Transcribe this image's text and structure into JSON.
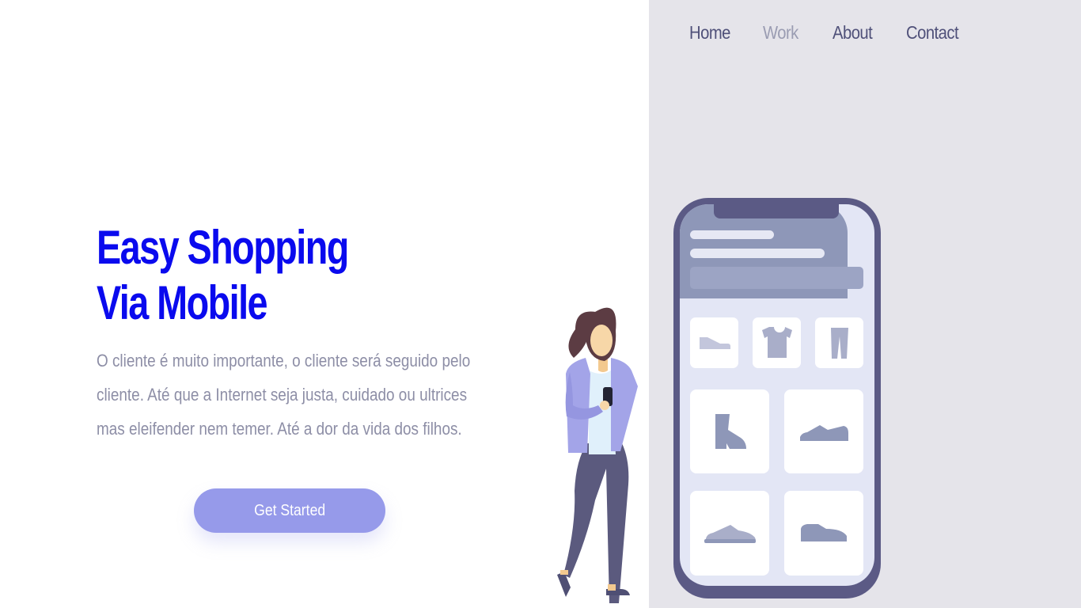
{
  "nav": {
    "items": [
      {
        "label": "Home",
        "active": false
      },
      {
        "label": "Work",
        "active": true
      },
      {
        "label": "About",
        "active": false
      },
      {
        "label": "Contact",
        "active": false
      }
    ]
  },
  "hero": {
    "title_line1": "Easy Shopping",
    "title_line2": "Via Mobile",
    "description": "O cliente é muito importante, o cliente será seguido pelo cliente. Até que a Internet seja justa, cuidado ou ultrices mas eleifender nem temer. Até a dor da vida dos filhos.",
    "cta_label": "Get Started"
  },
  "colors": {
    "title": "#0a0aee",
    "nav_text": "#4f5079",
    "nav_active": "#9a9cb2",
    "body_text": "#8d8ea6",
    "button": "#969aea",
    "panel": "#e5e4ea"
  },
  "illustration": {
    "icons": [
      "flat-shoe-icon",
      "tshirt-icon",
      "pants-icon",
      "boot-icon",
      "sneaker-icon",
      "sneaker-icon",
      "sneaker-icon"
    ]
  }
}
